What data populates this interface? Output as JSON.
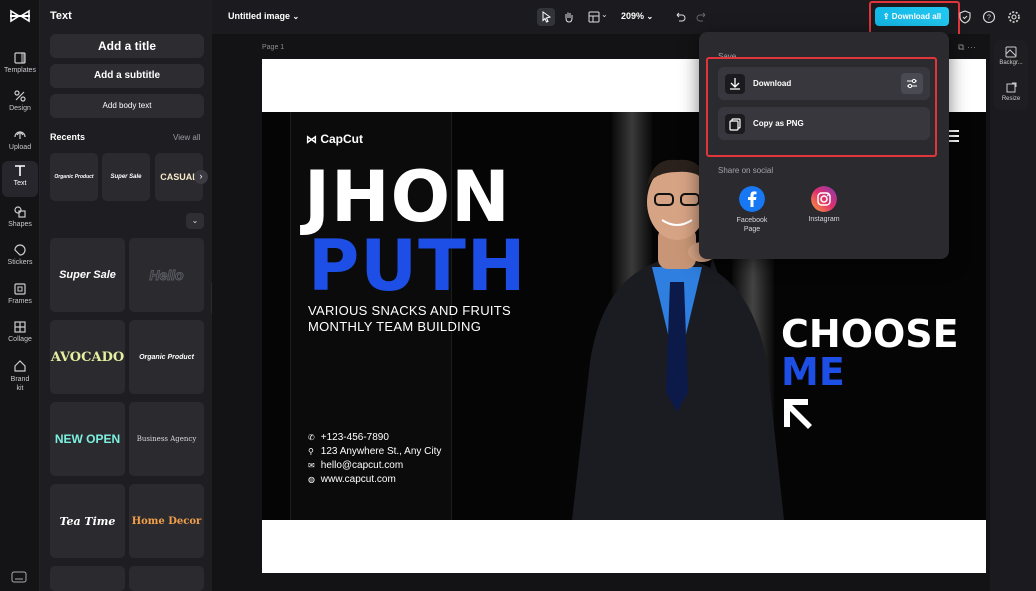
{
  "topbar": {
    "doc_title": "Untitled image",
    "zoom": "209%",
    "download_all": "Download all"
  },
  "rail": {
    "items": [
      {
        "label": "Templates",
        "icon": "templates-icon"
      },
      {
        "label": "Design",
        "icon": "design-icon"
      },
      {
        "label": "Upload",
        "icon": "upload-icon"
      },
      {
        "label": "Text",
        "icon": "text-icon"
      },
      {
        "label": "Shapes",
        "icon": "shapes-icon"
      },
      {
        "label": "Stickers",
        "icon": "stickers-icon"
      },
      {
        "label": "Frames",
        "icon": "frames-icon"
      },
      {
        "label": "Collage",
        "icon": "collage-icon"
      },
      {
        "label": "Brand kit",
        "icon": "brand-kit-icon"
      }
    ],
    "active": "Text"
  },
  "panel": {
    "title": "Text",
    "add_title": "Add a title",
    "add_subtitle": "Add a subtitle",
    "add_body": "Add body text",
    "recents_label": "Recents",
    "view_all": "View all",
    "recents": [
      "Organic Product",
      "Super Sale",
      "CASUAL"
    ],
    "tiles": [
      {
        "text": "Super Sale",
        "color": "#ffffff"
      },
      {
        "text": "Hello",
        "color": "#3a3a40"
      },
      {
        "text": "AVOCADO",
        "color": "#e8f0a0"
      },
      {
        "text": "Organic Product",
        "color": "#ffffff"
      },
      {
        "text": "NEW OPEN",
        "color": "#7df0e0"
      },
      {
        "text": "Business Agency",
        "color": "#d8d8d8"
      },
      {
        "text": "Tea Time",
        "color": "#ffffff"
      },
      {
        "text": "Home Decor",
        "color": "#f3a04a"
      }
    ]
  },
  "canvas": {
    "page_label": "Page 1",
    "poster": {
      "brand": "CapCut",
      "first_name": "JHON",
      "last_name": "PUTH",
      "subtitle_1": "VARIOUS SNACKS AND FRUITS",
      "subtitle_2": "MONTHLY TEAM BUILDING",
      "phone": "+123-456-7890",
      "address": "123 Anywhere St., Any City",
      "email": "hello@capcut.com",
      "website": "www.capcut.com",
      "choose": "CHOOSE",
      "me": "ME"
    }
  },
  "right_tools": {
    "background": "Backgr...",
    "resize": "Resize"
  },
  "popup": {
    "save_label": "Save",
    "download": "Download",
    "copy_png": "Copy as PNG",
    "share_label": "Share on social",
    "facebook": "Facebook Page",
    "instagram": "Instagram"
  },
  "colors": {
    "accent": "#1fc0ec",
    "highlight": "#e0353a",
    "poster_blue": "#1d4fe6"
  }
}
